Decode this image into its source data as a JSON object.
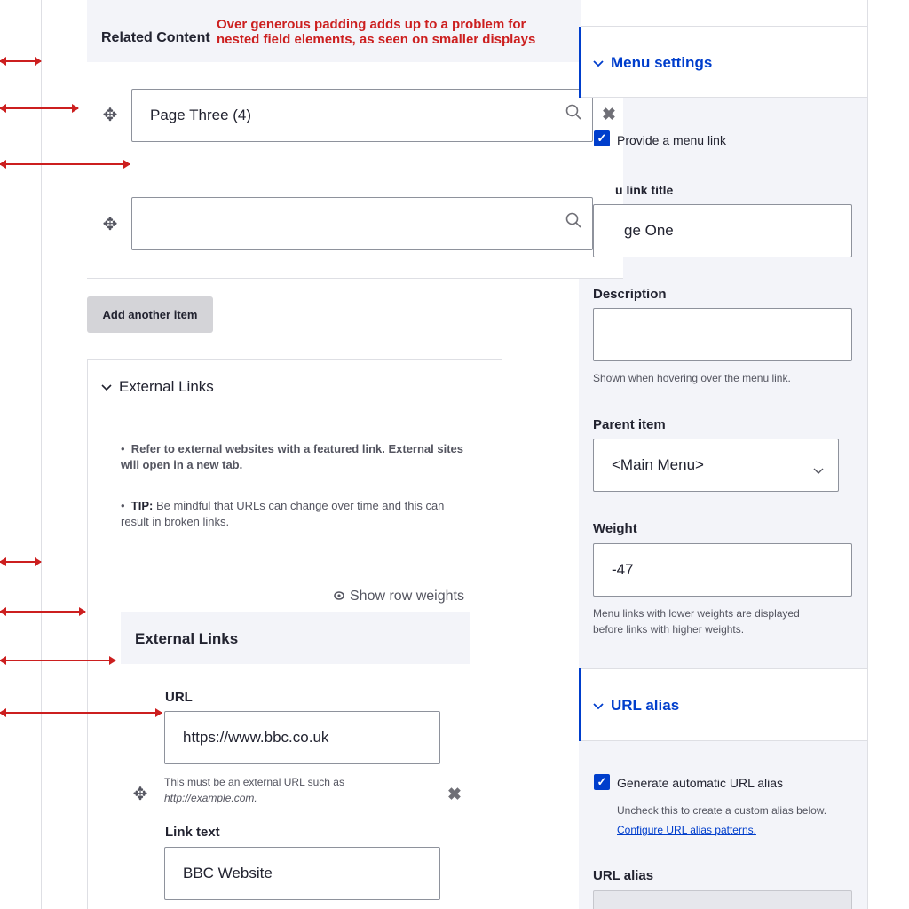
{
  "annotation": {
    "line1": "Over generous padding adds up to a problem for",
    "line2": "nested field elements, as seen on smaller displays"
  },
  "related": {
    "heading": "Related Content",
    "item1_value": "Page Three (4)",
    "item2_value": "",
    "add_button": "Add another item"
  },
  "external": {
    "section_title": "External Links",
    "note1_bold": "Refer to external websites with a featured link. External sites will open in a new tab.",
    "note2_bold": "TIP:",
    "note2_text": " Be mindful that URLs can change over time and this can result in broken links.",
    "show_weights": "Show row weights",
    "table_header": "External Links",
    "url_label": "URL",
    "url_value": "https://www.bbc.co.uk",
    "url_help_1": "This must be an external URL such as",
    "url_help_2": "http://example.com.",
    "link_text_label": "Link text",
    "link_text_value": "BBC Website"
  },
  "sidebar": {
    "menu_settings_title": "Menu settings",
    "provide_menu_link": "Provide a menu link",
    "menu_link_title_label": "u link title",
    "menu_link_title_value": "ge One",
    "description_label": "Description",
    "description_value": "",
    "description_help": "Shown when hovering over the menu link.",
    "parent_item_label": "Parent item",
    "parent_item_value": "<Main Menu>",
    "weight_label": "Weight",
    "weight_value": "-47",
    "weight_help_1": "Menu links with lower weights are displayed",
    "weight_help_2": "before links with higher weights.",
    "url_alias_title": "URL alias",
    "generate_alias": "Generate automatic URL alias",
    "generate_alias_help": "Uncheck this to create a custom alias below.",
    "configure_link": "Configure URL alias patterns.",
    "url_alias_label": "URL alias"
  },
  "icons": {
    "drag": "✥",
    "search": "⚲",
    "remove": "✖",
    "chevron": "⌄",
    "check": "✓",
    "eye": "⊙"
  },
  "colors": {
    "accent": "#003ecc",
    "annotation": "#cc1f1f",
    "panel": "#f3f4f9"
  }
}
